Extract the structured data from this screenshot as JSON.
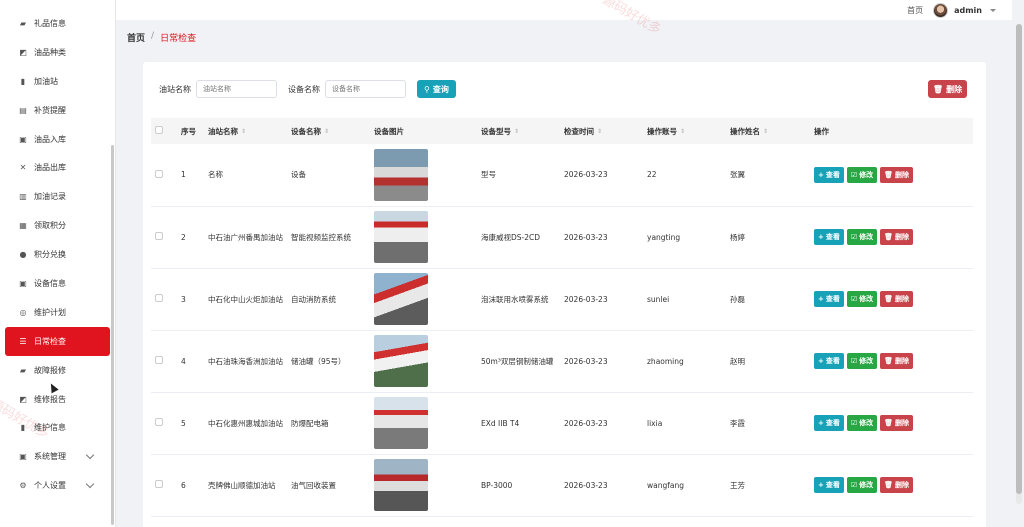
{
  "sidebar": {
    "items": [
      {
        "label": "礼品信息",
        "icon": "gift-icon",
        "glyph": "▰"
      },
      {
        "label": "油品种类",
        "icon": "chart-icon",
        "glyph": "◩"
      },
      {
        "label": "加油站",
        "icon": "bar-chart-icon",
        "glyph": "▮"
      },
      {
        "label": "补货提醒",
        "icon": "document-icon",
        "glyph": "▤"
      },
      {
        "label": "油品入库",
        "icon": "clipboard-icon",
        "glyph": "▣"
      },
      {
        "label": "油品出库",
        "icon": "shuffle-icon",
        "glyph": "✕"
      },
      {
        "label": "加油记录",
        "icon": "bars-icon",
        "glyph": "▥"
      },
      {
        "label": "领取积分",
        "icon": "grid-icon",
        "glyph": "▦"
      },
      {
        "label": "积分兑换",
        "icon": "user-icon",
        "glyph": "●"
      },
      {
        "label": "设备信息",
        "icon": "clipboard-icon",
        "glyph": "▣"
      },
      {
        "label": "维护计划",
        "icon": "lifebuoy-icon",
        "glyph": "◎"
      },
      {
        "label": "日常检查",
        "icon": "sliders-icon",
        "glyph": "☰"
      },
      {
        "label": "故障报修",
        "icon": "gift-icon",
        "glyph": "▰"
      },
      {
        "label": "维修报告",
        "icon": "chart-icon",
        "glyph": "◩"
      },
      {
        "label": "维护信息",
        "icon": "bar-chart-icon",
        "glyph": "▮"
      },
      {
        "label": "系统管理",
        "icon": "clipboard-icon",
        "glyph": "▣"
      },
      {
        "label": "个人设置",
        "icon": "gear-icon",
        "glyph": "⚙"
      }
    ]
  },
  "topbar": {
    "home": "首页",
    "username": "admin"
  },
  "breadcrumb": {
    "home": "首页",
    "separator": "/",
    "current": "日常检查"
  },
  "filters": {
    "station_label": "油站名称",
    "station_placeholder": "油站名称",
    "device_label": "设备名称",
    "device_placeholder": "设备名称",
    "query_label": "查询"
  },
  "delete_label": "删除",
  "table": {
    "headers": [
      "序号",
      "油站名称",
      "设备名称",
      "设备图片",
      "设备型号",
      "检查时间",
      "操作账号",
      "操作姓名",
      "操作"
    ],
    "rows": [
      {
        "no": "1",
        "station": "名称",
        "device": "设备",
        "model": "型号",
        "time": "2026-03-23",
        "account": "22",
        "name": "张翼"
      },
      {
        "no": "2",
        "station": "中石油广州番禺加油站",
        "device": "智能视频监控系统",
        "model": "海康威视DS-2CD",
        "time": "2026-03-23",
        "account": "yangting",
        "name": "杨婷"
      },
      {
        "no": "3",
        "station": "中石化中山火炬加油站",
        "device": "自动消防系统",
        "model": "泡沫联用水喷雾系统",
        "time": "2026-03-23",
        "account": "sunlei",
        "name": "孙磊"
      },
      {
        "no": "4",
        "station": "中石油珠海香洲加油站",
        "device": "储油罐（95号）",
        "model": "50m³双层钢制储油罐",
        "time": "2026-03-23",
        "account": "zhaoming",
        "name": "赵明"
      },
      {
        "no": "5",
        "station": "中石化惠州惠城加油站",
        "device": "防爆配电箱",
        "model": "EXd IIB T4",
        "time": "2026-03-23",
        "account": "lixia",
        "name": "李霞"
      },
      {
        "no": "6",
        "station": "壳牌佛山顺德加油站",
        "device": "油气回收装置",
        "model": "BP-3000",
        "time": "2026-03-23",
        "account": "wangfang",
        "name": "王芳"
      }
    ],
    "actions": {
      "view": "查看",
      "edit": "修改",
      "delete": "删除"
    }
  },
  "watermark": "源码好优多",
  "colors": {
    "accent": "#e0141e",
    "info": "#17a2b8",
    "success": "#28a745",
    "danger": "#c9434a"
  }
}
